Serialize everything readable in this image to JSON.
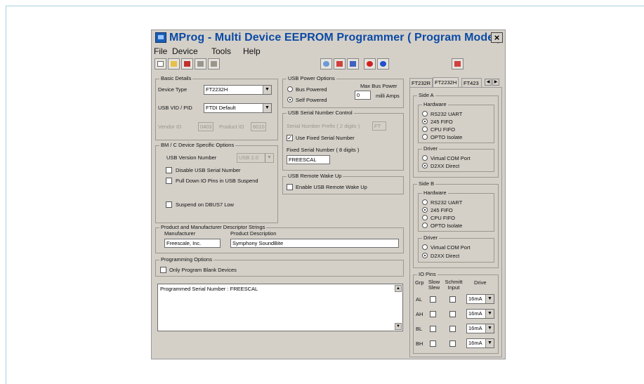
{
  "window": {
    "title": "MProg - Multi Device EEPROM Programmer ( Program Mode )"
  },
  "menu": {
    "file": "File",
    "device": "Device",
    "tools": "Tools",
    "help": "Help"
  },
  "toolbar": {
    "left_icons": [
      "new-file-icon",
      "open-folder-icon",
      "edit-icon",
      "disabled-icon",
      "disabled-icon"
    ],
    "right_icons": [
      "search-icon",
      "window-icon",
      "wrench-icon",
      "help-icon",
      "info-icon",
      "window-icon"
    ]
  },
  "basic": {
    "title": "Basic Details",
    "device_type_label": "Device Type",
    "device_type_value": "FT2232H",
    "vidpid_label": "USB VID / PID",
    "vidpid_value": "FTDI Default",
    "vendor_label": "Vendor ID",
    "vendor_value": "0403",
    "product_label": "Product ID",
    "product_value": "6010"
  },
  "bm": {
    "title": "BM / C Device Specific Options",
    "usb_version_label": "USB Version Number",
    "usb_version_value": "USB 2.0",
    "disable_serial": "Disable USB Serial Number",
    "pulldown": "Pull Down IO Pins in USB Suspend",
    "suspend": "Suspend on DBUS7 Low"
  },
  "power": {
    "title": "USB Power Options",
    "bus": "Bus Powered",
    "self": "Self Powered",
    "max_label": "Max Bus Power",
    "max_value": "0",
    "ma_label": "milli Amps"
  },
  "serial": {
    "title": "USB Serial Number Control",
    "prefix_label": "Serial Number Prefix ( 2 digits )",
    "prefix_value": "FT",
    "use_fixed": "Use Fixed Serial Number",
    "fixed_label": "Fixed Serial Number ( 8 digits )",
    "fixed_value": "FREESCAL"
  },
  "wake": {
    "title": "USB Remote Wake Up",
    "enable": "Enable USB Remote Wake Up"
  },
  "strings": {
    "title": "Product and Manufacturer Descriptor Strings",
    "manufacturer_label": "Manufacturer",
    "manufacturer_value": "Freescale, Inc.",
    "product_label": "Product Description",
    "product_value": "Symphony SoundBite"
  },
  "prog": {
    "title": "Programming Options",
    "only_blank": "Only Program Blank Devices"
  },
  "log": {
    "text": "Programmed Serial Number : FREESCAL"
  },
  "tabs": [
    "FT232R",
    "FT2232H",
    "FT423"
  ],
  "sideA": {
    "title": "Side A",
    "hw_title": "Hardware",
    "hw": [
      "RS232 UART",
      "245 FIFO",
      "CPU FIFO",
      "OPTO Isolate"
    ],
    "hw_selected": 1,
    "drv_title": "Driver",
    "drv": [
      "Virtual COM Port",
      "D2XX Direct"
    ],
    "drv_selected": 1
  },
  "sideB": {
    "title": "Side B",
    "hw_title": "Hardware",
    "hw": [
      "RS232 UART",
      "245 FIFO",
      "CPU FIFO",
      "OPTO Isolate"
    ],
    "hw_selected": 1,
    "drv_title": "Driver",
    "drv": [
      "Virtual COM Port",
      "D2XX Direct"
    ],
    "drv_selected": 1
  },
  "io": {
    "title": "IO Pins",
    "grp": "Grp",
    "slow": "Slow Slew",
    "schmitt": "Schmitt Input",
    "drive": "Drive",
    "rows": [
      {
        "name": "AL",
        "drive": "16mA"
      },
      {
        "name": "AH",
        "drive": "16mA"
      },
      {
        "name": "BL",
        "drive": "16mA"
      },
      {
        "name": "BH",
        "drive": "16mA"
      }
    ]
  }
}
